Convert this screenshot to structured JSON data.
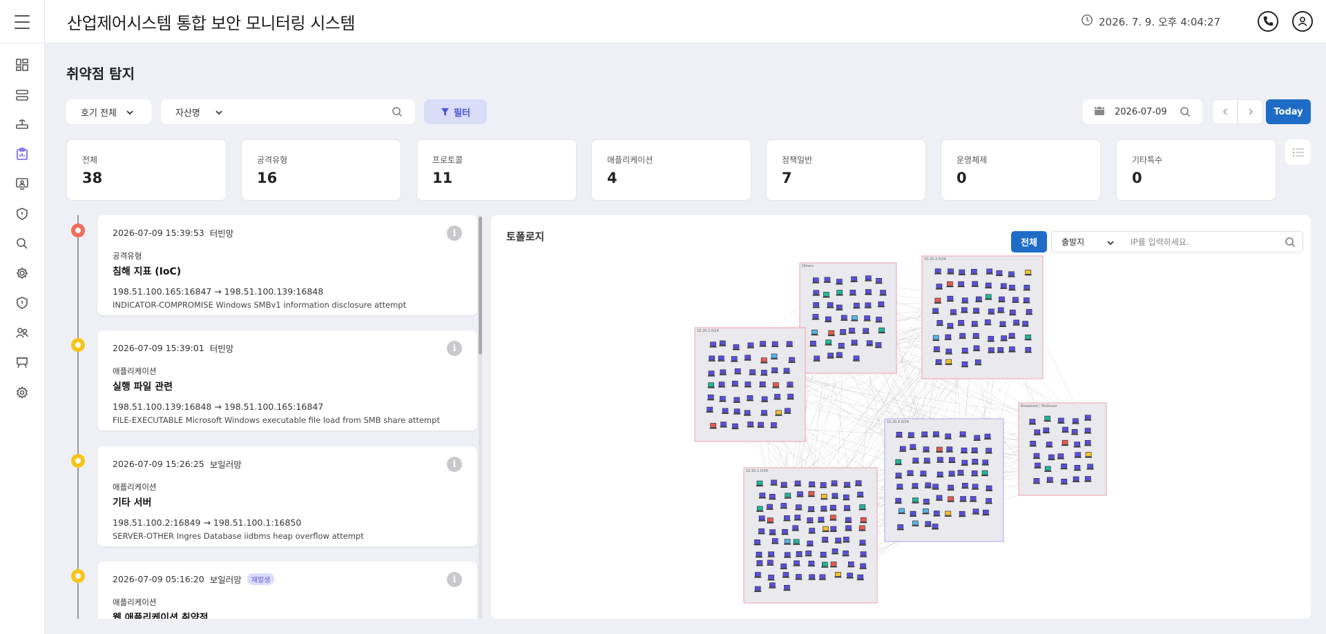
{
  "header": {
    "title": "산업제어시스템 통합 보안 모니터링 시스템",
    "datetime": "2026. 7. 9. 오후 4:04:27"
  },
  "page": {
    "title": "취약점 탐지"
  },
  "filters": {
    "unit_select": "호기 전체",
    "asset_select": "자산명",
    "filter_button": "필터",
    "date": "2026-07-09",
    "today_button": "Today"
  },
  "stats": [
    {
      "label": "전체",
      "value": "38"
    },
    {
      "label": "공격유형",
      "value": "16"
    },
    {
      "label": "프로토콜",
      "value": "11"
    },
    {
      "label": "애플리케이션",
      "value": "4"
    },
    {
      "label": "정책일반",
      "value": "7"
    },
    {
      "label": "운영체제",
      "value": "0"
    },
    {
      "label": "기타특수",
      "value": "0"
    }
  ],
  "events": [
    {
      "time": "2026-07-09 15:39:53",
      "network": "터빈망",
      "badge": "",
      "category": "공격유형",
      "name": "침해 지표 (IoC)",
      "flow": "198.51.100.165:16847 → 198.51.100.139:16848",
      "signature": "INDICATOR-COMPROMISE Windows SMBv1 information disclosure attempt",
      "severity_color": "#f26b5b"
    },
    {
      "time": "2026-07-09 15:39:01",
      "network": "터빈망",
      "badge": "",
      "category": "애플리케이션",
      "name": "실행 파일 관련",
      "flow": "198.51.100.139:16848 → 198.51.100.165:16847",
      "signature": "FILE-EXECUTABLE Microsoft Windows executable file load from SMB share attempt",
      "severity_color": "#f5c518"
    },
    {
      "time": "2026-07-09 15:26:25",
      "network": "보일러망",
      "badge": "",
      "category": "애플리케이션",
      "name": "기타 서버",
      "flow": "198.51.100.2:16849 → 198.51.100.1:16850",
      "signature": "SERVER-OTHER Ingres Database iidbms heap overflow attempt",
      "severity_color": "#f5c518"
    },
    {
      "time": "2026-07-09 05:16:20",
      "network": "보일러망",
      "badge": "재발생",
      "category": "애플리케이션",
      "name": "웹 애플리케이션 취약점",
      "flow": "",
      "signature": "",
      "severity_color": "#f5c518"
    }
  ],
  "topology": {
    "title": "토폴로지",
    "all_button": "전체",
    "source_select": "출발지",
    "ip_placeholder": "IP를 입력하세요.",
    "groups": [
      {
        "label": "Others",
        "count": 40
      },
      {
        "label": "10.20.3.0/24",
        "count": 60
      },
      {
        "label": "10.20.2.0/24",
        "count": 48
      },
      {
        "label": "Broadcast / Multicast",
        "count": 30
      },
      {
        "label": "10.20.4.0/24",
        "count": 60
      },
      {
        "label": "10.20.1.0/24",
        "count": 84
      }
    ]
  },
  "colors": {
    "accent": "#1e6cc6",
    "nav_active": "#6a5cf0",
    "severity_high": "#f26b5b",
    "severity_mid": "#f5c518",
    "node": "#5b4fe0"
  }
}
